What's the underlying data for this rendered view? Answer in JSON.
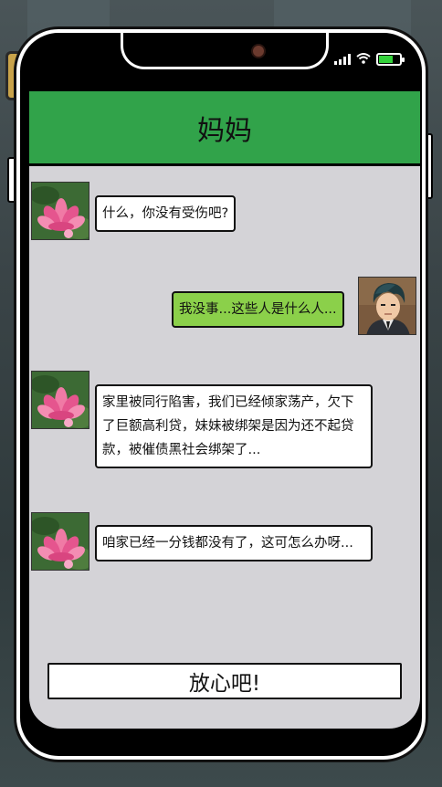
{
  "status_bar": {
    "signal_icon": "cellular-signal-icon",
    "wifi_icon": "wifi-icon",
    "battery_icon": "battery-icon",
    "battery_color": "#33d13a",
    "battery_level": 0.7
  },
  "chat": {
    "contact_name": "妈妈",
    "header_color": "#31a34a",
    "messages": [
      {
        "sender": "mom",
        "avatar_icon": "lotus-flower-avatar",
        "text": "什么，你没有受伤吧?"
      },
      {
        "sender": "player",
        "avatar_icon": "young-man-avatar",
        "text": "我没事...这些人是什么人..."
      },
      {
        "sender": "mom",
        "avatar_icon": "lotus-flower-avatar",
        "text": "家里被同行陷害，我们已经倾家荡产，欠下了巨额高利贷，妹妹被绑架是因为还不起贷款，被催债黑社会绑架了..."
      },
      {
        "sender": "mom",
        "avatar_icon": "lotus-flower-avatar",
        "text": "咱家已经一分钱都没有了，这可怎么办呀..."
      }
    ]
  },
  "reply_option": {
    "label": "放心吧!"
  }
}
